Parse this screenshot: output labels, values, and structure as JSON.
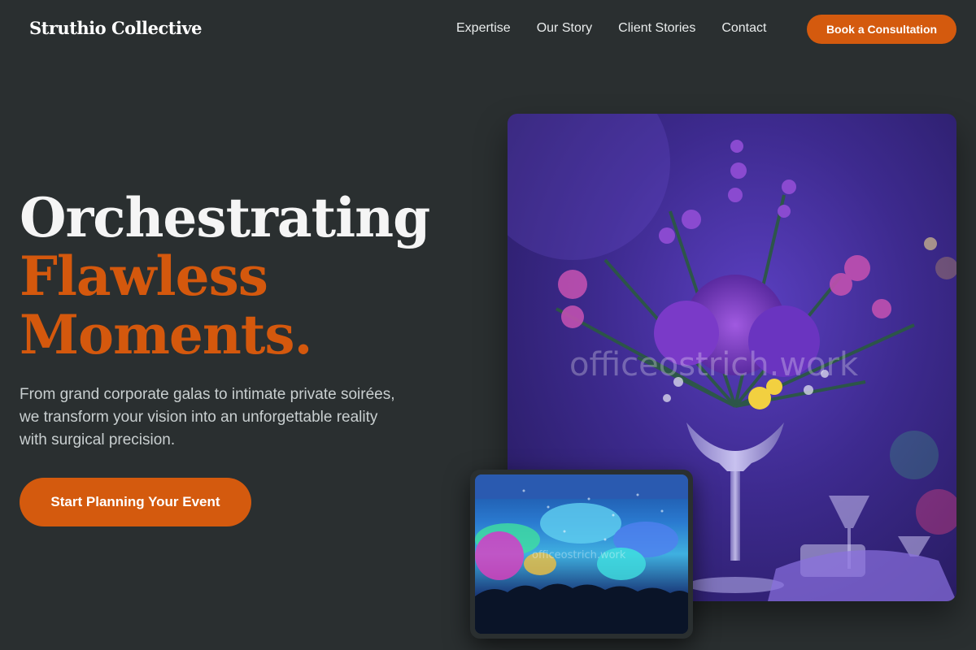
{
  "brand": {
    "name": "Struthio Collective",
    "accent": "#d45a0e"
  },
  "nav": {
    "links": [
      "Expertise",
      "Our Story",
      "Client Stories",
      "Contact"
    ],
    "cta": "Book a Consultation"
  },
  "hero": {
    "line1": "Orchestrating",
    "line2": "Flawless",
    "line3": "Moments.",
    "subtitle": "From grand corporate galas to intimate private soirées, we transform your vision into an unforgettable reality with surgical precision.",
    "cta": "Start Planning Your Event"
  },
  "images": {
    "main_watermark": "officeostrich.work",
    "small_watermark": "officeostrich.work"
  }
}
